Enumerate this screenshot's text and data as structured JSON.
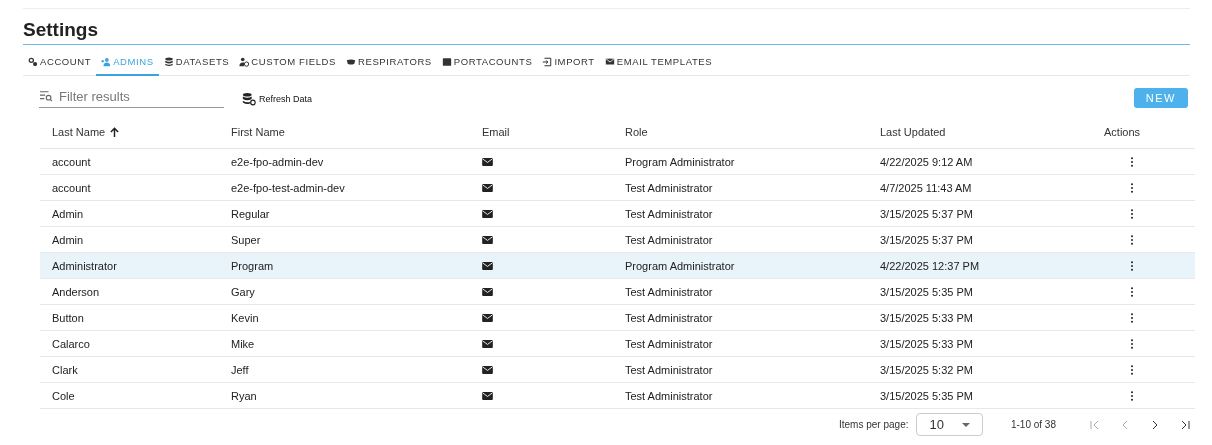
{
  "title": "Settings",
  "tabs": [
    {
      "label": "ACCOUNT",
      "selected": false
    },
    {
      "label": "ADMINS",
      "selected": true
    },
    {
      "label": "DATASETS",
      "selected": false
    },
    {
      "label": "CUSTOM FIELDS",
      "selected": false
    },
    {
      "label": "RESPIRATORS",
      "selected": false
    },
    {
      "label": "PORTACOUNTS",
      "selected": false
    },
    {
      "label": "IMPORT",
      "selected": false
    },
    {
      "label": "EMAIL TEMPLATES",
      "selected": false
    }
  ],
  "filter": {
    "placeholder": "Filter results"
  },
  "refresh_button": "Refresh Data",
  "new_button": "NEW",
  "table": {
    "columns": [
      {
        "label": "Last Name",
        "sorted": true
      },
      {
        "label": "First Name",
        "sorted": false
      },
      {
        "label": "Email",
        "sorted": false
      },
      {
        "label": "Role",
        "sorted": false
      },
      {
        "label": "Last Updated",
        "sorted": false
      },
      {
        "label": "Actions",
        "sorted": false
      }
    ],
    "rows": [
      {
        "last_name": "account",
        "first_name": "e2e-fpo-admin-dev",
        "role": "Program Administrator",
        "last_updated": "4/22/2025 9:12 AM",
        "selected": false
      },
      {
        "last_name": "account",
        "first_name": "e2e-fpo-test-admin-dev",
        "role": "Test Administrator",
        "last_updated": "4/7/2025 11:43 AM",
        "selected": false
      },
      {
        "last_name": "Admin",
        "first_name": "Regular",
        "role": "Test Administrator",
        "last_updated": "3/15/2025 5:37 PM",
        "selected": false
      },
      {
        "last_name": "Admin",
        "first_name": "Super",
        "role": "Test Administrator",
        "last_updated": "3/15/2025 5:37 PM",
        "selected": false
      },
      {
        "last_name": "Administrator",
        "first_name": "Program",
        "role": "Program Administrator",
        "last_updated": "4/22/2025 12:37 PM",
        "selected": true
      },
      {
        "last_name": "Anderson",
        "first_name": "Gary",
        "role": "Test Administrator",
        "last_updated": "3/15/2025 5:35 PM",
        "selected": false
      },
      {
        "last_name": "Button",
        "first_name": "Kevin",
        "role": "Test Administrator",
        "last_updated": "3/15/2025 5:33 PM",
        "selected": false
      },
      {
        "last_name": "Calarco",
        "first_name": "Mike",
        "role": "Test Administrator",
        "last_updated": "3/15/2025 5:33 PM",
        "selected": false
      },
      {
        "last_name": "Clark",
        "first_name": "Jeff",
        "role": "Test Administrator",
        "last_updated": "3/15/2025 5:32 PM",
        "selected": false
      },
      {
        "last_name": "Cole",
        "first_name": "Ryan",
        "role": "Test Administrator",
        "last_updated": "3/15/2025 5:35 PM",
        "selected": false
      }
    ]
  },
  "paginator": {
    "label": "Items per page:",
    "page_size": "10",
    "range": "1-10 of 38"
  }
}
